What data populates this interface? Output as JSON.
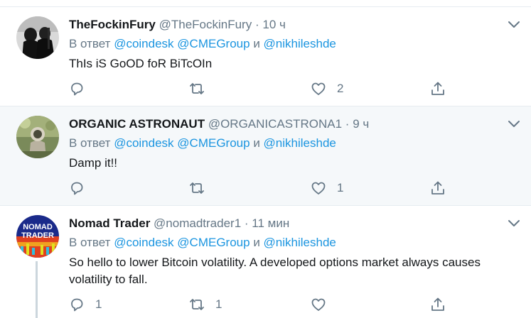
{
  "reply_prefix": "В ответ",
  "and_word": "и",
  "tweets": [
    {
      "name": "TheFockinFury",
      "handle": "@TheFockinFury",
      "dot": "·",
      "time": "10 ч",
      "mentions": [
        "@coindesk",
        "@CMEGroup",
        "@nikhileshde"
      ],
      "text": "ThIs iS GoOD foR BiTcOIn",
      "reply_count": "",
      "retweet_count": "",
      "like_count": "2"
    },
    {
      "name": "ORGANIC ASTRONAUT",
      "handle": "@ORGANICASTRONA1",
      "dot": "·",
      "time": "9 ч",
      "mentions": [
        "@coindesk",
        "@CMEGroup",
        "@nikhileshde"
      ],
      "text": "Damp it!!",
      "reply_count": "",
      "retweet_count": "",
      "like_count": "1"
    },
    {
      "name": "Nomad Trader",
      "handle": "@nomadtrader1",
      "dot": "·",
      "time": "11 мин",
      "mentions": [
        "@coindesk",
        "@CMEGroup",
        "@nikhileshde"
      ],
      "text": "So hello to lower Bitcoin volatility. A developed options market always causes volatility to fall.",
      "reply_count": "1",
      "retweet_count": "1",
      "like_count": "",
      "avatar_text_1": "NOMAD",
      "avatar_text_2": "TRADER"
    }
  ],
  "colors": {
    "link": "#1b95e0",
    "muted": "#657786",
    "text": "#14171a",
    "divider": "#e6ecf0",
    "highlight_bg": "#f5f8fa"
  },
  "icons": [
    "chevron-down-icon",
    "reply-icon",
    "retweet-icon",
    "like-icon",
    "share-icon"
  ]
}
